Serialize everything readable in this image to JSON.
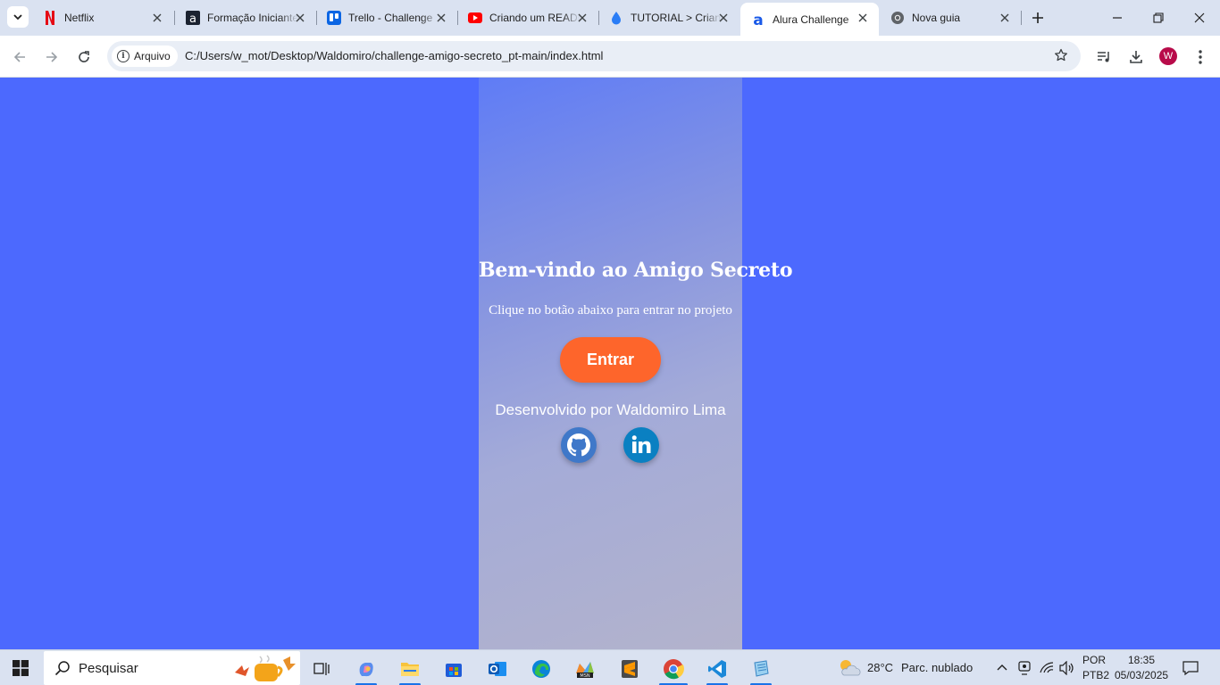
{
  "browser": {
    "tabs": [
      {
        "title": "Netflix",
        "icon": "netflix-icon"
      },
      {
        "title": "Formação Iniciante",
        "icon": "alura-icon"
      },
      {
        "title": "Trello - Challenge",
        "icon": "trello-icon"
      },
      {
        "title": "Criando um README",
        "icon": "youtube-icon"
      },
      {
        "title": "TUTORIAL > Criando",
        "icon": "drop-icon"
      },
      {
        "title": "Alura Challenge",
        "icon": "alura-icon",
        "active": true
      },
      {
        "title": "Nova guia",
        "icon": "chrome-icon"
      }
    ],
    "chip_label": "Arquivo",
    "url": "C:/Users/w_mot/Desktop/Waldomiro/challenge-amigo-secreto_pt-main/index.html",
    "profile_initial": "W"
  },
  "page": {
    "title": "Bem-vindo ao Amigo Secreto",
    "subtitle": "Clique no botão abaixo para entrar no projeto",
    "enter_label": "Entrar",
    "developer": "Desenvolvido por Waldomiro Lima",
    "social": [
      {
        "name": "GitHub",
        "icon": "github-icon"
      },
      {
        "name": "LinkedIn",
        "icon": "linkedin-icon"
      }
    ],
    "colors": {
      "background": "#4c69fe",
      "button": "#fe652b"
    }
  },
  "taskbar": {
    "search_placeholder": "Pesquisar",
    "weather_temp": "28°C",
    "weather_desc": "Parc. nublado",
    "lang_line1": "POR",
    "lang_line2": "PTB2",
    "time": "18:35",
    "date": "05/03/2025"
  }
}
